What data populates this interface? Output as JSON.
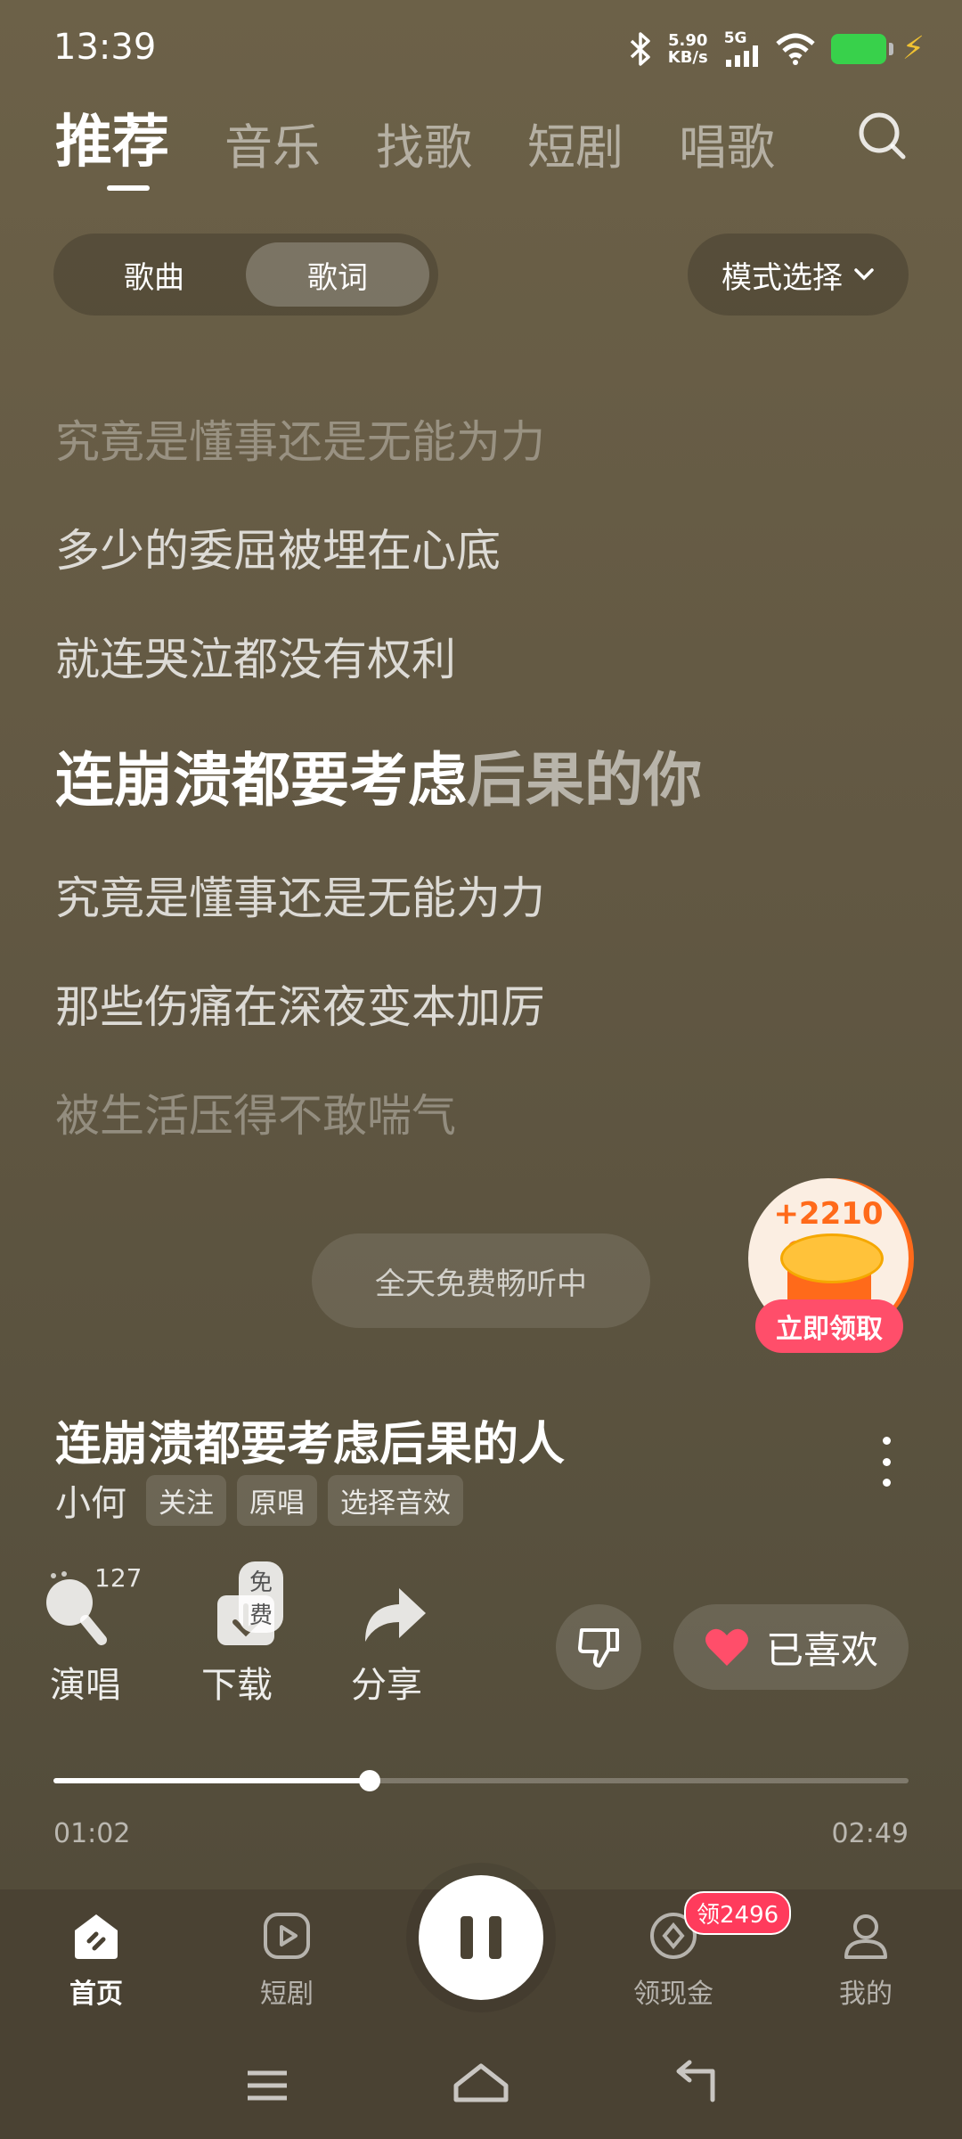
{
  "status_bar": {
    "time": "13:39",
    "net_speed_value": "5.90",
    "net_speed_unit": "KB/s",
    "network": "5G",
    "icons": [
      "bluetooth-icon",
      "signal-icon",
      "wifi-icon",
      "battery-icon",
      "charging-icon"
    ]
  },
  "top_tabs": [
    {
      "label": "推荐",
      "active": true
    },
    {
      "label": "音乐",
      "active": false
    },
    {
      "label": "找歌",
      "active": false
    },
    {
      "label": "短剧",
      "active": false
    },
    {
      "label": "唱歌",
      "active": false
    }
  ],
  "segment": {
    "options": [
      {
        "label": "歌曲",
        "active": false
      },
      {
        "label": "歌词",
        "active": true
      }
    ]
  },
  "mode_select": {
    "label": "模式选择"
  },
  "lyrics": {
    "lines": [
      "究竟是懂事还是无能为力",
      "多少的委屈被埋在心底",
      "就连哭泣都没有权利",
      "究竟是懂事还是无能为力",
      "那些伤痛在深夜变本加厉",
      "被生活压得不敢喘气"
    ],
    "current_sung": "连崩溃都要考虑",
    "current_rest": "后果的你"
  },
  "free_notice": "全天免费畅听中",
  "reward": {
    "amount": "+2210",
    "button": "立即领取"
  },
  "song": {
    "title": "连崩溃都要考虑后果的人",
    "artist": "小何",
    "tags": [
      "关注",
      "原唱",
      "选择音效"
    ]
  },
  "actions": {
    "sing": {
      "label": "演唱",
      "count": "127"
    },
    "download": {
      "label": "下载",
      "badge": "免费"
    },
    "share": {
      "label": "分享"
    },
    "liked": {
      "label": "已喜欢"
    }
  },
  "playback": {
    "current": "01:02",
    "total": "02:49",
    "progress": 0.37
  },
  "bottom_nav": [
    {
      "label": "首页",
      "icon": "home-icon",
      "active": true
    },
    {
      "label": "短剧",
      "icon": "video-play-icon",
      "active": false
    },
    {
      "label": "领现金",
      "icon": "cash-coin-icon",
      "active": false,
      "badge": "领2496"
    },
    {
      "label": "我的",
      "icon": "profile-icon",
      "active": false
    }
  ],
  "colors": {
    "accent_red": "#ff4e6a",
    "reward_orange": "#ff6a1a",
    "battery_green": "#38d14b"
  }
}
